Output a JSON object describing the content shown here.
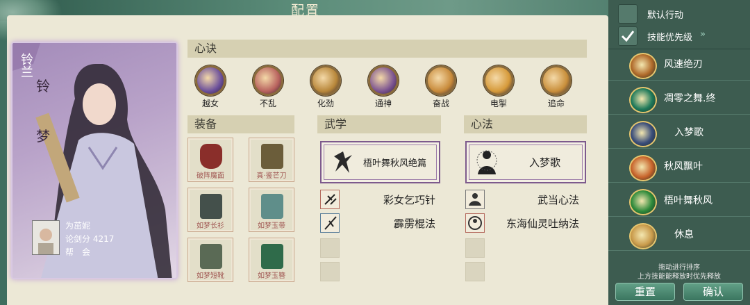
{
  "window": {
    "title": "配置"
  },
  "character": {
    "name_vertical_1": "铃兰",
    "name_vertical_2": "铃",
    "name_vertical_3": "梦",
    "master_name": "为茁妮",
    "score_label": "论剑分",
    "score_value": "4217",
    "guild_label": "帮　会"
  },
  "sections": {
    "xinjue": "心诀",
    "equipment": "装备",
    "wuxue": "武学",
    "xinfa": "心法"
  },
  "xinjue_skills": [
    {
      "label": "越女",
      "color": "#6b4f9b",
      "icon": "crescent-blade-icon"
    },
    {
      "label": "不乱",
      "color": "#b8625e",
      "icon": "meditating-figure-icon"
    },
    {
      "label": "化劲",
      "color": "#b8873a",
      "icon": "swirl-icon"
    },
    {
      "label": "通神",
      "color": "#7a5290",
      "icon": "helmet-icon"
    },
    {
      "label": "奋战",
      "color": "#c88a3a",
      "icon": "warrior-icon"
    },
    {
      "label": "电掣",
      "color": "#d69a3a",
      "icon": "lightning-bracket-icon"
    },
    {
      "label": "追命",
      "color": "#c98f3b",
      "icon": "dash-icon"
    }
  ],
  "equipment": [
    {
      "label": "破阵魔面",
      "icon": "demon-mask-icon"
    },
    {
      "label": "真·鉴芒刀",
      "icon": "saber-icon"
    },
    {
      "label": "如梦长衫",
      "icon": "robe-icon"
    },
    {
      "label": "如梦玉带",
      "icon": "jade-belt-icon"
    },
    {
      "label": "如梦短靴",
      "icon": "boots-icon"
    },
    {
      "label": "如梦玉簪",
      "icon": "hairpin-icon"
    }
  ],
  "wuxue": {
    "main": "梧叶舞秋风绝篇",
    "rows": [
      "彩女乞巧针",
      "霹雳棍法"
    ]
  },
  "xinfa": {
    "main": "入梦歌",
    "rows": [
      "武当心法",
      "东海仙灵吐纳法"
    ]
  },
  "sidebar": {
    "default_action": "默认行动",
    "skill_priority": "技能优先级",
    "items": [
      {
        "label": "风速绝刃",
        "color": "#b06a2a"
      },
      {
        "label": "凋零之舞.终",
        "color": "#1f7a5a"
      },
      {
        "label": "入梦歌",
        "color": "#3a4d7a"
      },
      {
        "label": "秋风飘叶",
        "color": "#c7632a"
      },
      {
        "label": "梧叶舞秋风",
        "color": "#2e8a3a"
      },
      {
        "label": "休息",
        "color": "#c99a4a"
      }
    ],
    "hint_1": "拖动进行排序",
    "hint_2": "上方技能能释放时优先释放",
    "reset": "重置",
    "confirm": "确认"
  }
}
